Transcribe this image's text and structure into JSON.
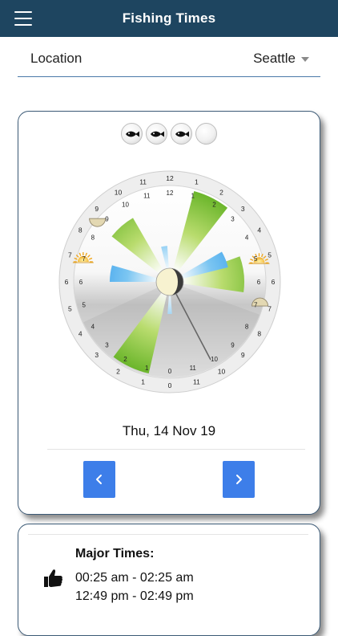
{
  "app": {
    "title": "Fishing Times"
  },
  "location": {
    "label": "Location",
    "value": "Seattle"
  },
  "rating": {
    "level": 3,
    "max": 4
  },
  "dial": {
    "outer_numbers": [
      "12",
      "1",
      "2",
      "3",
      "4",
      "5",
      "6",
      "7",
      "8",
      "9",
      "10",
      "11",
      "0",
      "1",
      "2",
      "3",
      "4",
      "5",
      "6",
      "7",
      "8",
      "9",
      "10",
      "11"
    ],
    "inner_numbers": [
      "12",
      "1",
      "2",
      "3",
      "4",
      "5",
      "6",
      "7",
      "8",
      "9",
      "10",
      "11",
      "0",
      "1",
      "2",
      "3",
      "4",
      "5",
      "6",
      "7",
      "8",
      "9",
      "10",
      "11"
    ]
  },
  "date": "Thu, 14 Nov 19",
  "nav": {
    "prev": "‹",
    "next": "›"
  },
  "times": {
    "heading": "Major Times:",
    "entries": [
      "00:25 am - 02:25 am",
      "12:49 pm - 02:49 pm"
    ]
  },
  "colors": {
    "navbar": "#1e4560",
    "accent": "#3d7ee9",
    "major_green": "#8fc43a",
    "minor_blue": "#2a9fe8"
  }
}
